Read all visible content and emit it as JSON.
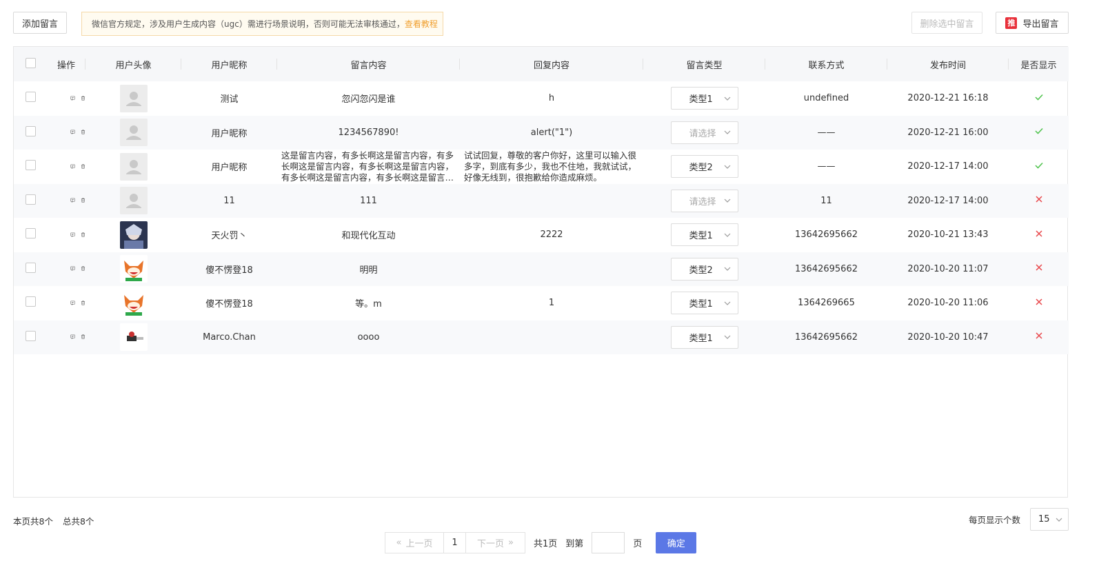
{
  "toolbar": {
    "add_label": "添加留言",
    "notice_text": "微信官方规定，涉及用户生成内容（ugc）需进行场景说明，否则可能无法审核通过，",
    "notice_link": "查看教程",
    "delete_selected_label": "删除选中留言",
    "export_badge": "推",
    "export_label": "导出留言"
  },
  "table": {
    "headers": [
      "操作",
      "用户头像",
      "用户昵称",
      "留言内容",
      "回复内容",
      "留言类型",
      "联系方式",
      "发布时间",
      "是否显示"
    ],
    "rows": [
      {
        "nickname": "测试",
        "content": "忽闪忽闪是谁",
        "reply": "h",
        "type": "类型1",
        "type_placeholder": false,
        "contact": "undefined",
        "time": "2020-12-21 16:18",
        "shown": true,
        "avatar": "default"
      },
      {
        "nickname": "用户昵称",
        "content": "1234567890!",
        "reply": "alert(\"1\")",
        "type": "请选择",
        "type_placeholder": true,
        "contact": "——",
        "time": "2020-12-21 16:00",
        "shown": true,
        "avatar": "default"
      },
      {
        "nickname": "用户昵称",
        "content": "这是留言内容，有多长啊这是留言内容，有多长啊这是留言内容，有多长啊这是留言内容，有多长啊这是留言内容，有多长啊这是留言内容",
        "reply": "试试回复，尊敬的客户你好，这里可以输入很多字，到底有多少，我也不住地，我就试试，好像无线到，很抱歉给你造成麻烦。",
        "type": "类型2",
        "type_placeholder": false,
        "contact": "——",
        "time": "2020-12-17 14:00",
        "shown": true,
        "avatar": "default",
        "multi": true
      },
      {
        "nickname": "11",
        "content": "111",
        "reply": "",
        "type": "请选择",
        "type_placeholder": true,
        "contact": "11",
        "time": "2020-12-17 14:00",
        "shown": false,
        "avatar": "default"
      },
      {
        "nickname": "天火罚丶",
        "content": "和现代化互动",
        "reply": "2222",
        "type": "类型1",
        "type_placeholder": false,
        "contact": "13642695662",
        "time": "2020-10-21 13:43",
        "shown": false,
        "avatar": "photo-anime"
      },
      {
        "nickname": "傻不愣登18",
        "content": "明明",
        "reply": "",
        "type": "类型2",
        "type_placeholder": false,
        "contact": "13642695662",
        "time": "2020-10-20 11:07",
        "shown": false,
        "avatar": "photo-fox"
      },
      {
        "nickname": "傻不愣登18",
        "content": "等。m",
        "reply": "1",
        "type": "类型1",
        "type_placeholder": false,
        "contact": "1364269665",
        "time": "2020-10-20 11:06",
        "shown": false,
        "avatar": "photo-fox"
      },
      {
        "nickname": "Marco.Chan",
        "content": "oooo",
        "reply": "",
        "type": "类型1",
        "type_placeholder": false,
        "contact": "13642695662",
        "time": "2020-10-20 10:47",
        "shown": false,
        "avatar": "photo-small"
      }
    ]
  },
  "footer": {
    "page_count_text": "本页共8个",
    "total_text": "总共8个",
    "prev_label": "上一页",
    "current_page": "1",
    "next_label": "下一页",
    "total_pages_text": "共1页",
    "goto_label": "到第",
    "page_unit": "页",
    "confirm_label": "确定",
    "page_size_label": "每页显示个数",
    "page_size": "15"
  },
  "colors": {
    "accent": "#5b78e6",
    "link": "#f0a030",
    "yes": "#4cc24a",
    "no": "#e8464a",
    "badge": "#e8303a"
  }
}
